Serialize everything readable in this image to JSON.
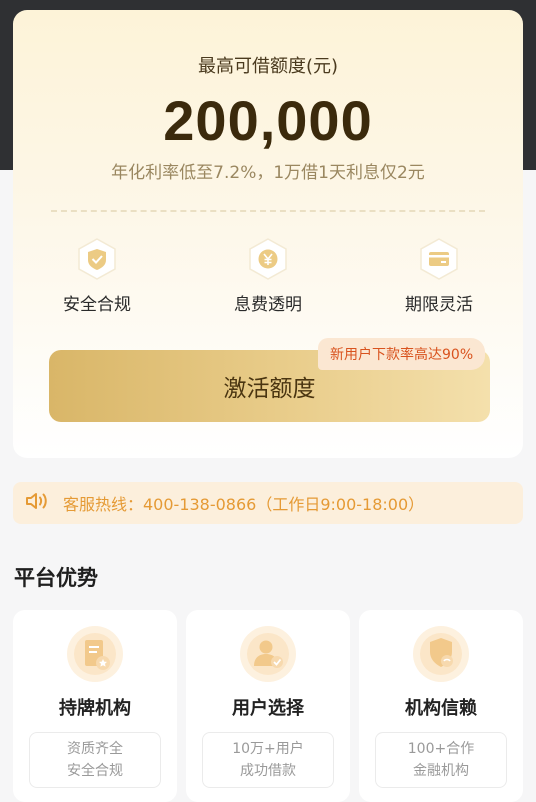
{
  "credit": {
    "title": "最高可借额度(元)",
    "amount": "200,000",
    "rate_text": "年化利率低至7.2%，1万借1天利息仅2元"
  },
  "features": [
    {
      "label": "安全合规",
      "icon": "shield-check-icon"
    },
    {
      "label": "息费透明",
      "icon": "yen-icon"
    },
    {
      "label": "期限灵活",
      "icon": "card-icon"
    }
  ],
  "action": {
    "button_label": "激活额度",
    "promo_badge": "新用户下款率高达90%"
  },
  "hotline": {
    "text": "客服热线：400-138-0866（工作日9:00-18:00）",
    "icon": "speaker-icon"
  },
  "platform": {
    "title": "平台优势",
    "items": [
      {
        "title": "持牌机构",
        "desc_line1": "资质齐全",
        "desc_line2": "安全合规",
        "icon": "license-icon"
      },
      {
        "title": "用户选择",
        "desc_line1": "10万+用户",
        "desc_line2": "成功借款",
        "icon": "user-check-icon"
      },
      {
        "title": "机构信赖",
        "desc_line1": "100+合作",
        "desc_line2": "金融机构",
        "icon": "handshake-shield-icon"
      }
    ]
  },
  "colors": {
    "accent_gold": "#d9b668",
    "promo_orange": "#d9531e",
    "hotline_orange": "#e59a35"
  }
}
